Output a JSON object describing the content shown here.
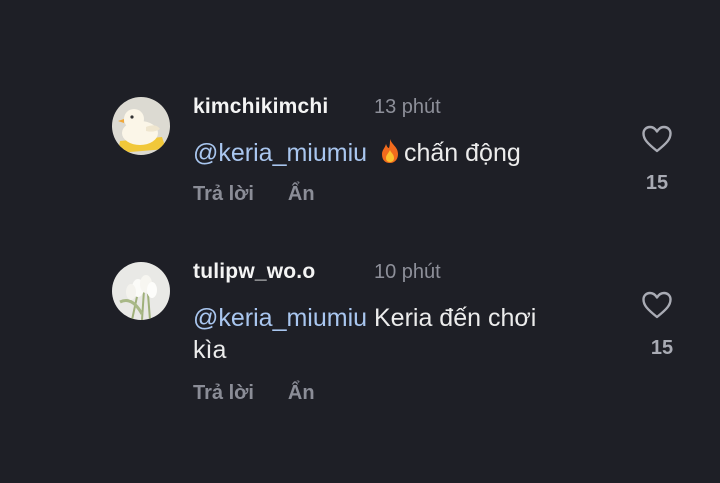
{
  "comments": [
    {
      "username": "kimchikimchi",
      "time": "13 phút",
      "mention": "@keria_miumiu",
      "emoji": "🔥",
      "text": "chấn động",
      "reply_label": "Trả lời",
      "hide_label": "Ẩn",
      "likes": "15",
      "avatar_icon": "yellow-cartoon-avatar"
    },
    {
      "username": "tulipw_wo.o",
      "time": "10 phút",
      "mention": "@keria_miumiu",
      "text": "Keria đến chơi kìa",
      "reply_label": "Trả lời",
      "hide_label": "Ẩn",
      "likes": "15",
      "avatar_icon": "white-tulips-avatar"
    }
  ],
  "colors": {
    "background": "#1e1f26",
    "mention": "#a9c6ef",
    "muted": "#8b8d97"
  }
}
